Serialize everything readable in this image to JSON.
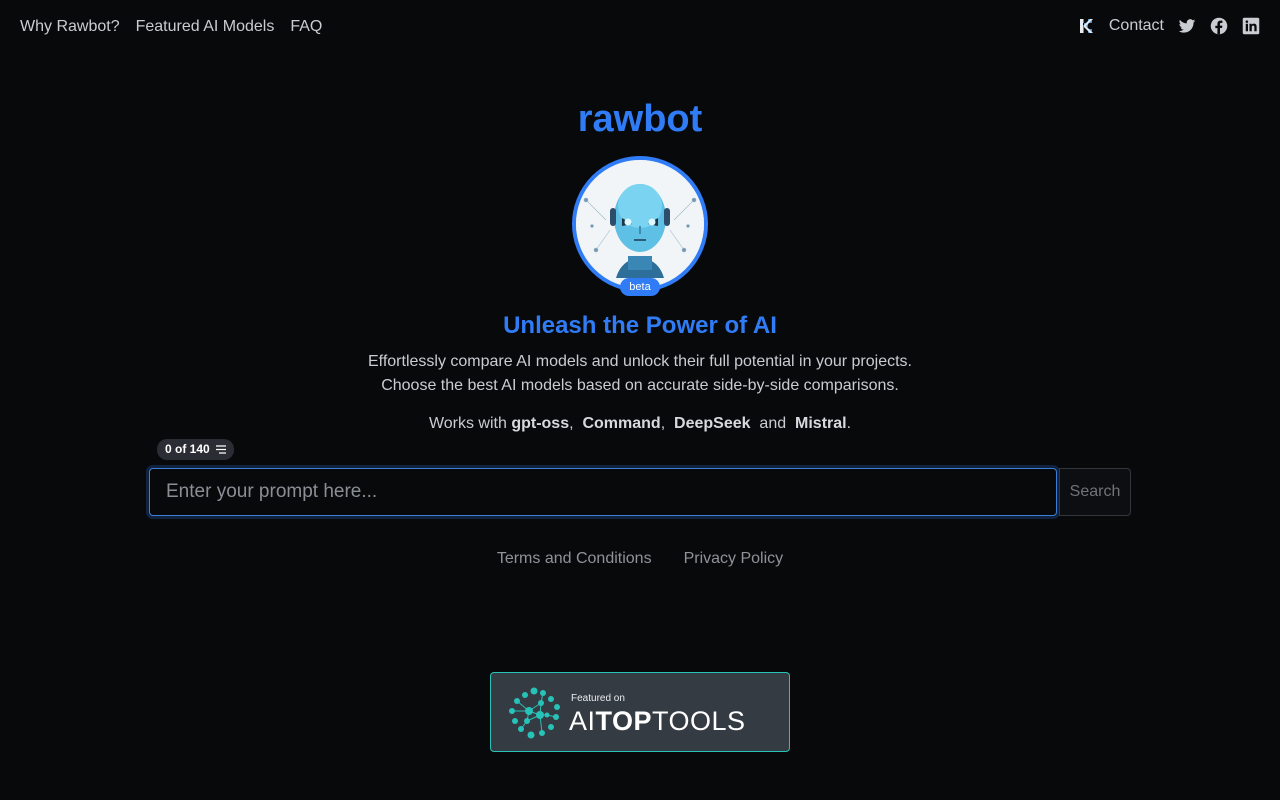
{
  "nav": {
    "links": [
      "Why Rawbot?",
      "Featured AI Models",
      "FAQ"
    ],
    "contact": "Contact",
    "icons": [
      "k-logo-icon",
      "twitter-icon",
      "facebook-icon",
      "linkedin-icon"
    ]
  },
  "hero": {
    "brand": "rawbot",
    "beta": "beta",
    "headline": "Unleash the Power of AI",
    "sub_line1": "Effortlessly compare AI models and unlock their full potential in your projects.",
    "sub_line2": "Choose the best AI models based on accurate side-by-side comparisons.",
    "works_prefix": "Works with",
    "models": [
      "gpt-oss",
      "Command",
      "DeepSeek",
      "Mistral"
    ],
    "works_and": "and"
  },
  "counter": {
    "label": "0 of 140"
  },
  "prompt": {
    "placeholder": "Enter your prompt here...",
    "value": ""
  },
  "search": {
    "label": "Search"
  },
  "footer": {
    "terms": "Terms and Conditions",
    "privacy": "Privacy Policy"
  },
  "badge": {
    "featured": "Featured on",
    "word_a": "AI",
    "word_b": "TOP",
    "word_c": "TOOLS"
  },
  "colors": {
    "accent": "#2f7cf6",
    "background": "#08090b",
    "badge_border": "#27c2b8"
  }
}
